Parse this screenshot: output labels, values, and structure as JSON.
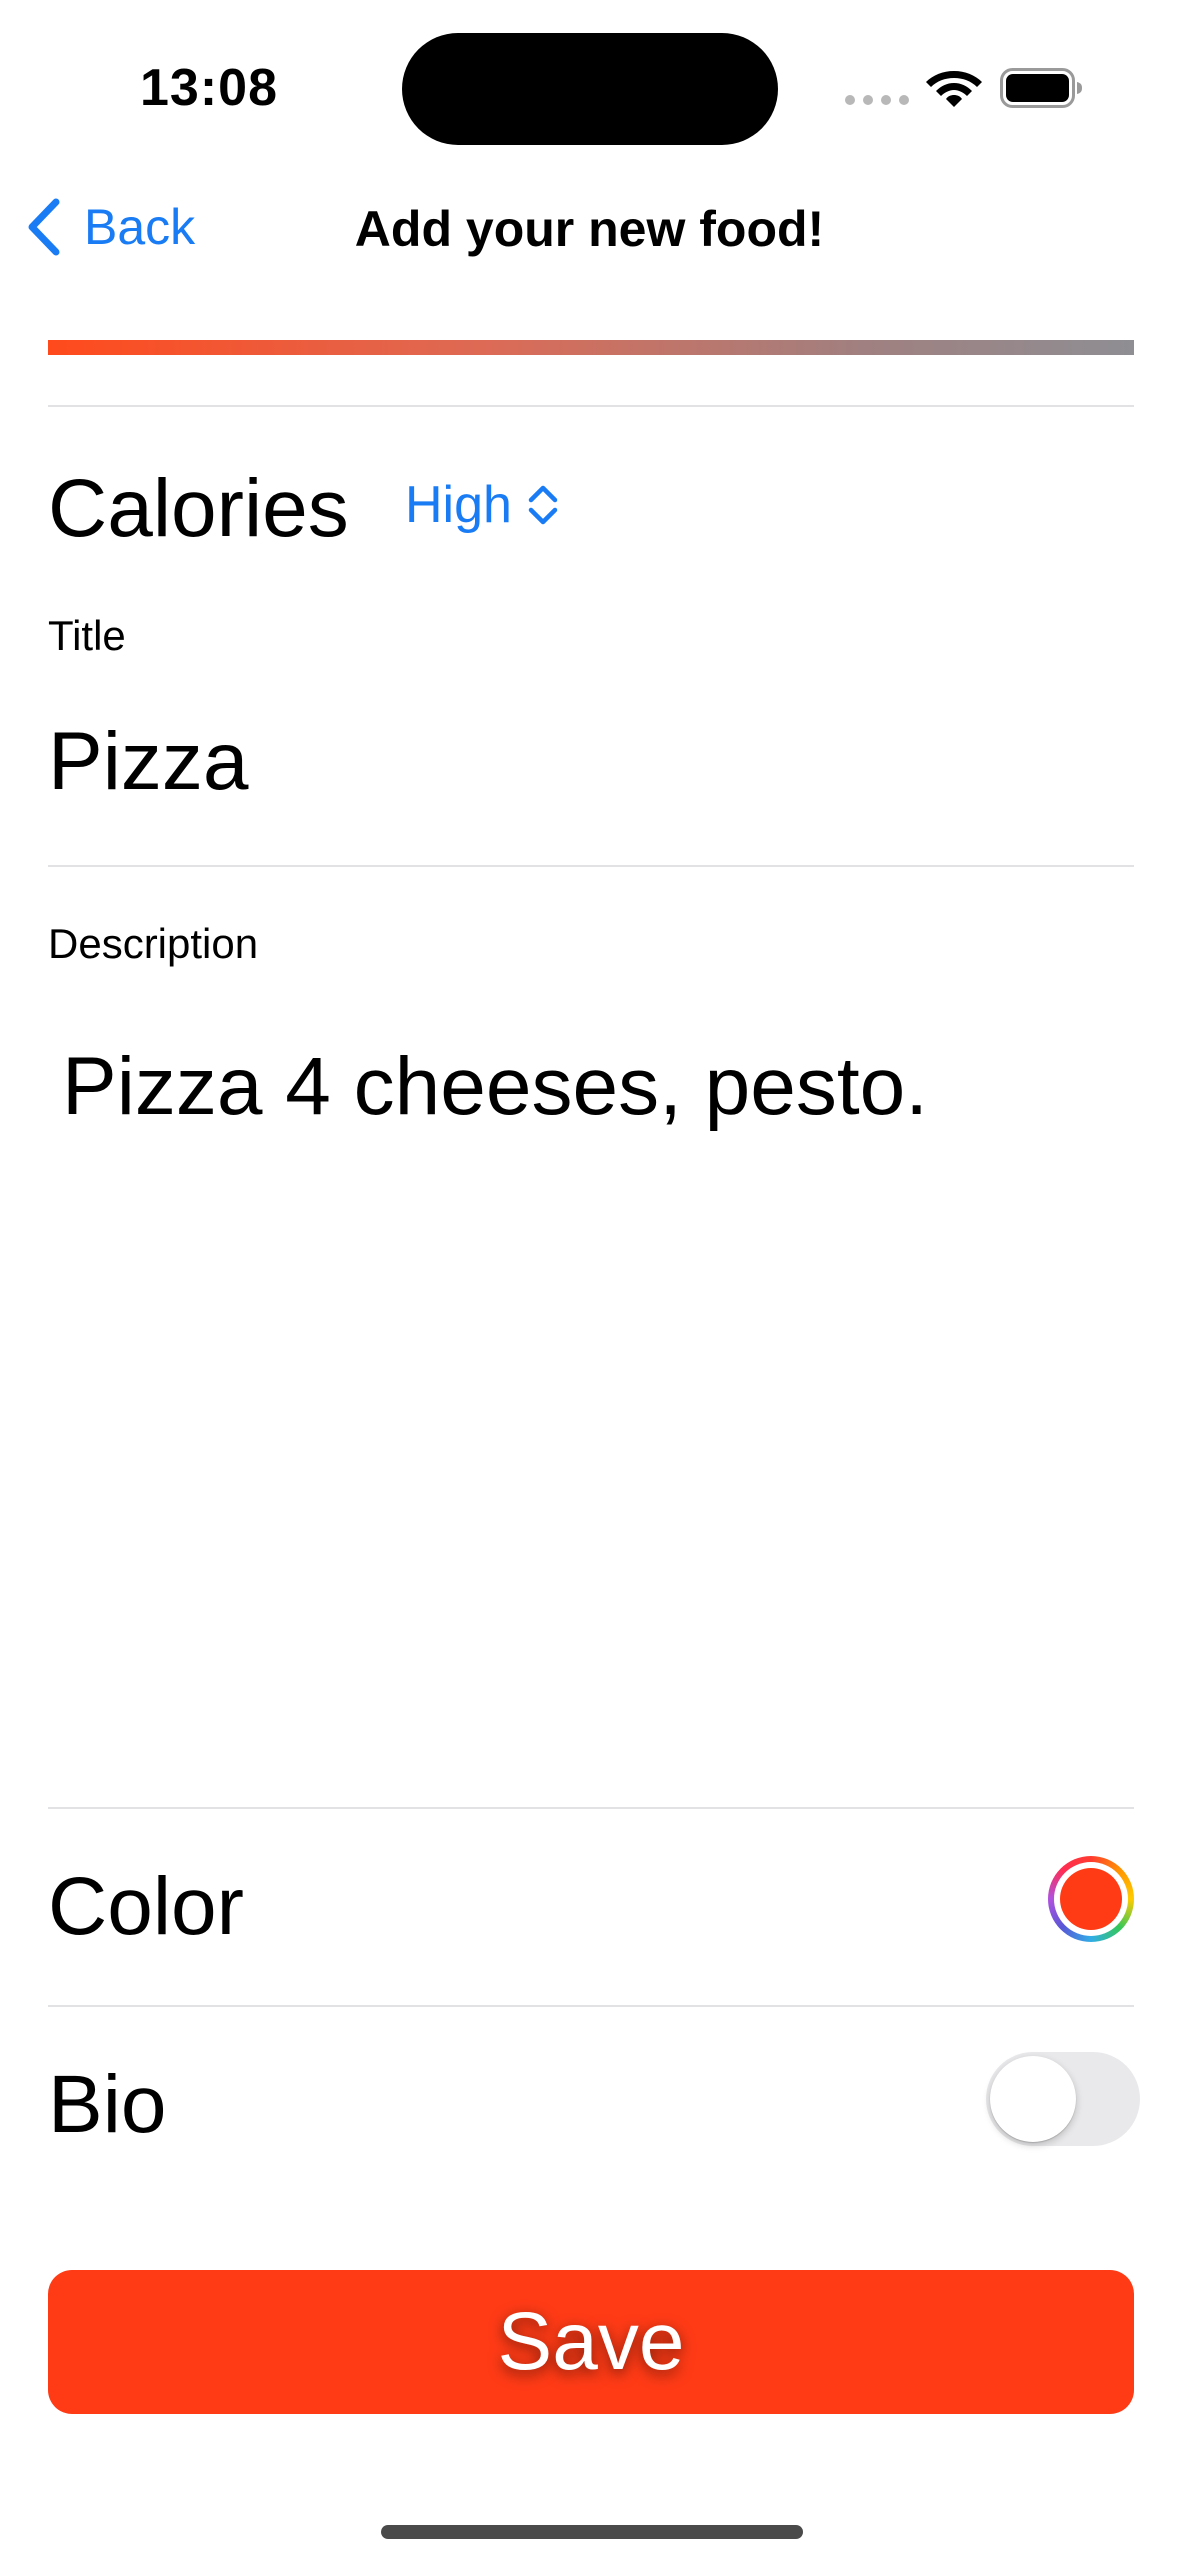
{
  "status_bar": {
    "time": "13:08"
  },
  "nav": {
    "back_label": "Back",
    "title": "Add your new food!"
  },
  "form": {
    "calories": {
      "label": "Calories",
      "value": "High"
    },
    "title_field": {
      "label": "Title",
      "value": "Pizza"
    },
    "description_field": {
      "label": "Description",
      "value": "Pizza 4 cheeses, pesto."
    },
    "color": {
      "label": "Color",
      "selected_color": "#ff3b16"
    },
    "bio": {
      "label": "Bio",
      "on": false
    }
  },
  "save_button": {
    "label": "Save",
    "color": "#ff3b16"
  },
  "colors": {
    "accent": "#1a7cf5",
    "gradient_start": "#ff4a1c",
    "gradient_end": "#8e8e93"
  },
  "icons": {
    "back": "chevron-left-icon",
    "picker": "chevron-up-down-icon",
    "wifi": "wifi-icon",
    "battery": "battery-icon"
  }
}
